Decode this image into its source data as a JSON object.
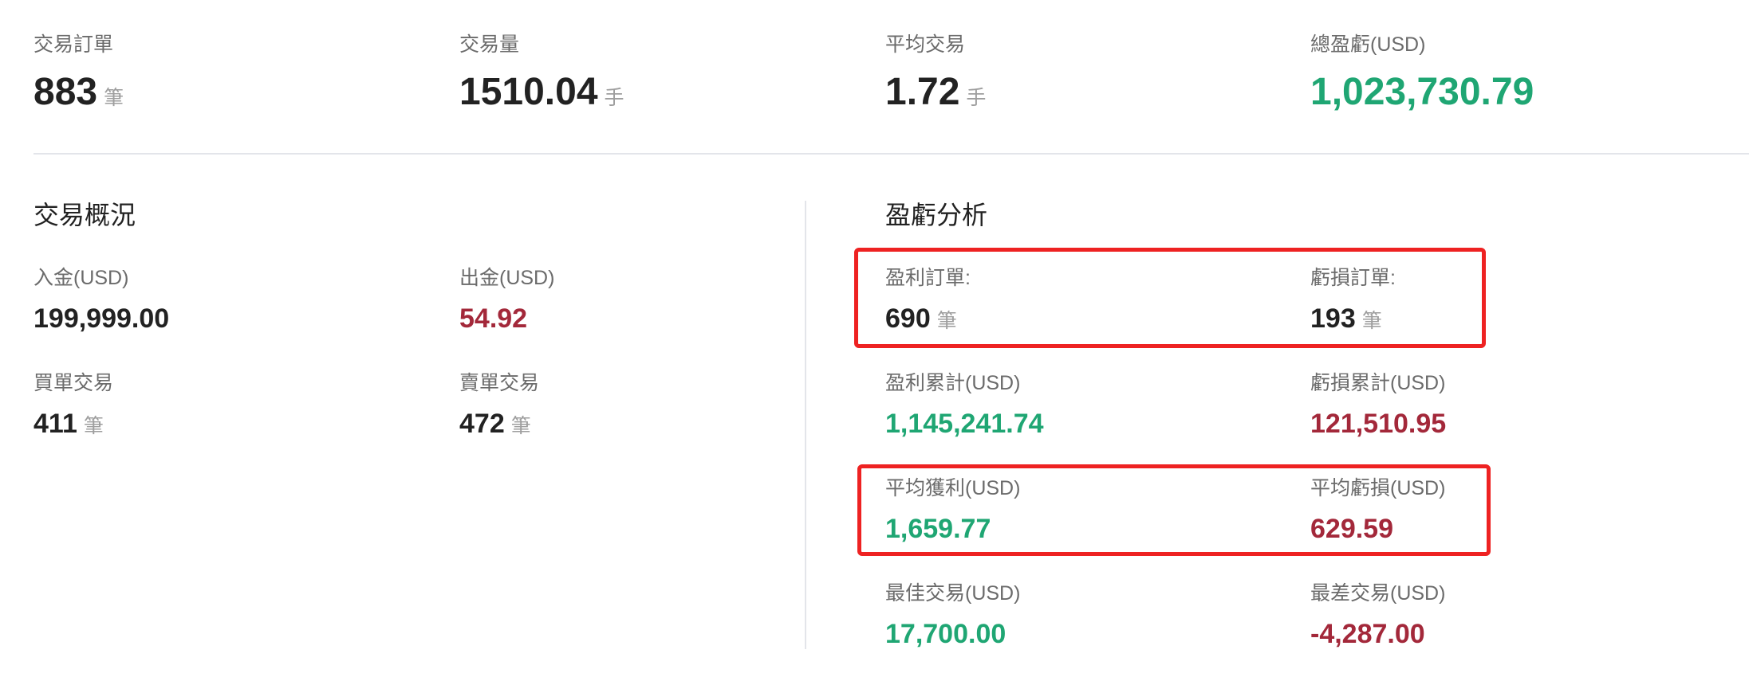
{
  "summary": {
    "orders": {
      "label": "交易訂單",
      "value": "883",
      "unit": "筆"
    },
    "volume": {
      "label": "交易量",
      "value": "1510.04",
      "unit": "手"
    },
    "avg_trade": {
      "label": "平均交易",
      "value": "1.72",
      "unit": "手"
    },
    "total_pnl": {
      "label": "總盈虧(USD)",
      "value": "1,023,730.79"
    }
  },
  "overview": {
    "title": "交易概況",
    "deposit": {
      "label": "入金(USD)",
      "value": "199,999.00"
    },
    "withdrawal": {
      "label": "出金(USD)",
      "value": "54.92"
    },
    "buy_trades": {
      "label": "買單交易",
      "value": "411",
      "unit": "筆"
    },
    "sell_trades": {
      "label": "賣單交易",
      "value": "472",
      "unit": "筆"
    }
  },
  "pnl_analysis": {
    "title": "盈虧分析",
    "profit_orders": {
      "label": "盈利訂單:",
      "value": "690",
      "unit": "筆"
    },
    "loss_orders": {
      "label": "虧損訂單:",
      "value": "193",
      "unit": "筆"
    },
    "profit_total": {
      "label": "盈利累計(USD)",
      "value": "1,145,241.74"
    },
    "loss_total": {
      "label": "虧損累計(USD)",
      "value": "121,510.95"
    },
    "avg_profit": {
      "label": "平均獲利(USD)",
      "value": "1,659.77"
    },
    "avg_loss": {
      "label": "平均虧損(USD)",
      "value": "629.59"
    },
    "best_trade": {
      "label": "最佳交易(USD)",
      "value": "17,700.00"
    },
    "worst_trade": {
      "label": "最差交易(USD)",
      "value": "-4,287.00"
    }
  },
  "colors": {
    "profit": "#1fa673",
    "loss": "#a3283a",
    "highlight": "#ee2222"
  }
}
